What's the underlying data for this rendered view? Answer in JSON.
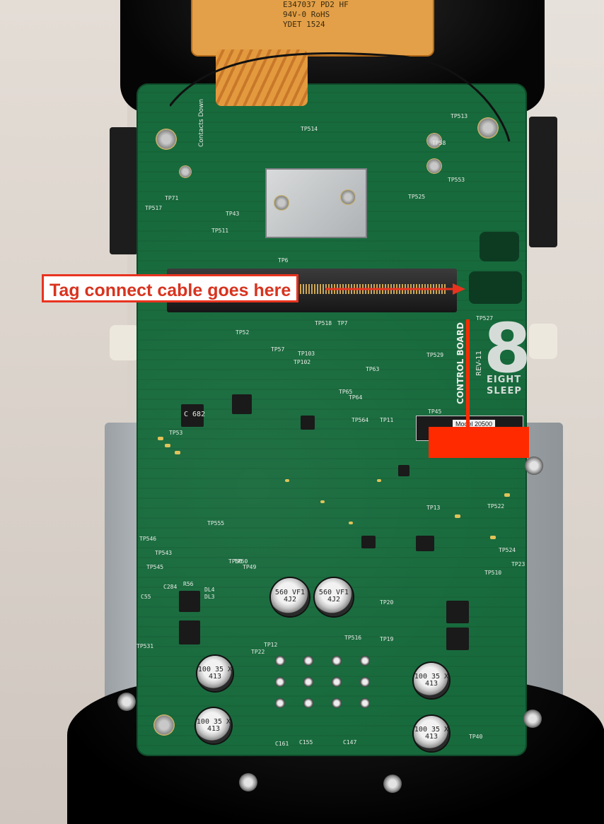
{
  "annotation": {
    "label": "Tag connect cable goes here",
    "color": "#e8331f"
  },
  "board": {
    "silkscreen_name": "CONTROL BOARD",
    "revision": "REV-11",
    "contacts_note": "Contacts Down",
    "logo_digit": "8",
    "brand_line_1": "EIGHT",
    "brand_line_2": "SLEEP",
    "model_label": "Model 20500",
    "pcb_color": "#176a3c"
  },
  "ribbon": {
    "lines": [
      "E347037 PD2 HF",
      "94V-0 RoHS",
      "YDET 1524"
    ]
  },
  "capacitors": [
    {
      "text": "560 VF1 4J2"
    },
    {
      "text": "560 VF1 4J2"
    },
    {
      "text": "100 35 X 413"
    },
    {
      "text": "100 35 X 413"
    },
    {
      "text": "100 35 X 413"
    },
    {
      "text": "100 35 X 413"
    }
  ],
  "silkscreen_labels": [
    "TP514",
    "TP527",
    "TP529",
    "TP52",
    "TP57",
    "TP103",
    "TP102",
    "TP564",
    "TP45",
    "TP555",
    "TP546",
    "TP543",
    "TP545",
    "TP524",
    "TP510",
    "TP516",
    "TP531",
    "TP22",
    "TP19",
    "TP522",
    "TP513",
    "TP553",
    "TP50",
    "TP49",
    "TP20",
    "TP40",
    "C284",
    "C55",
    "C161",
    "C155",
    "C147",
    "R56",
    "DL4",
    "DL3",
    "TP53",
    "TP50",
    "TP7",
    "TP518",
    "TP511",
    "TP43",
    "TP6",
    "TP517",
    "TP71",
    "TP525",
    "TP58",
    "TP63",
    "TP64",
    "TP65",
    "TP11",
    "TP12",
    "TP13",
    "TP23"
  ],
  "chips": [
    {
      "text": "C 682"
    }
  ]
}
